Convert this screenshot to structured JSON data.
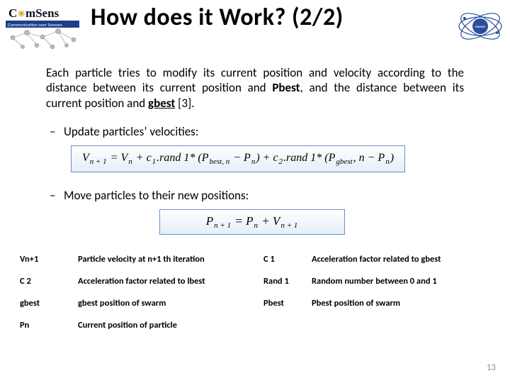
{
  "title": "How does it Work? (2/2)",
  "logoLeft": {
    "brand": "ComSens",
    "sub": "Communication over Sensors"
  },
  "logoRight": {
    "brand": "COMSATS"
  },
  "paragraph_pre": "Each particle tries to modify its current position and velocity according to the distance between its current position and ",
  "paragraph_pbest": "Pbest",
  "paragraph_mid": ", and the distance between its current position and ",
  "paragraph_gbest": "gbest",
  "paragraph_post": " [3].",
  "bullet1": "Update particles’ velocities:",
  "bullet2": "Move particles to their new positions:",
  "formula1_parts": {
    "a1": "V",
    "a1s": "n + 1",
    "eq1": " = ",
    "b1": "V",
    "b1s": "n",
    "plus1": " + c",
    "c1s": "1",
    "r1": ".rand 1* (P",
    "r1s": "best, n",
    "minus1": " − P",
    "m1s": "n",
    "close1": ") + c",
    "c2s": "2",
    "r2": ".rand 1* (P",
    "r2s": "gbest",
    "mid2": ", n − P",
    "m2s": "n",
    "close2": ")"
  },
  "formula2_parts": {
    "p1": "P",
    "p1s": "n + 1",
    "eq": " = ",
    "p2": "P",
    "p2s": "n",
    "plus": " + V",
    "vs": "n + 1"
  },
  "defs": [
    {
      "k": "Vn+1",
      "v": "Particle velocity at n+1 th iteration",
      "k2": "C 1",
      "v2": "Acceleration factor related to gbest"
    },
    {
      "k": "C 2",
      "v": "Acceleration factor related to lbest",
      "k2": "Rand 1",
      "v2": "Random number between 0 and 1"
    },
    {
      "k": "gbest",
      "v": "gbest position of swarm",
      "k2": "Pbest",
      "v2": "Pbest position of swarm"
    },
    {
      "k": "Pn",
      "v": "Current position of particle",
      "k2": "",
      "v2": ""
    }
  ],
  "pageNumber": "13"
}
